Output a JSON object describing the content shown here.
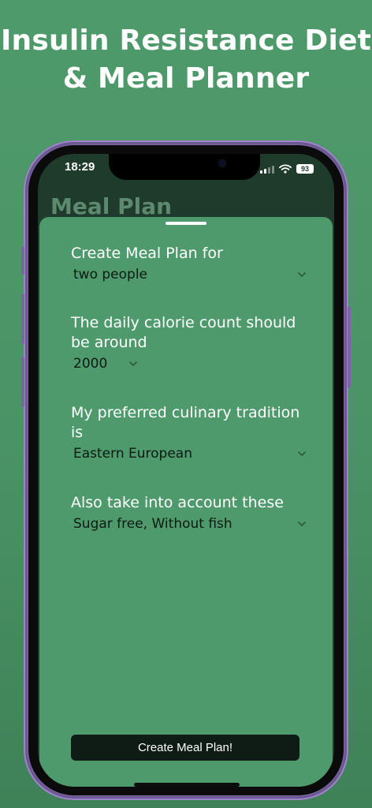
{
  "promo": {
    "line1": "Insulin Resistance Diet",
    "line2": "& Meal Planner"
  },
  "status_bar": {
    "time": "18:29",
    "battery": "93"
  },
  "screen": {
    "background_title": "Meal Plan"
  },
  "form": {
    "people": {
      "label": "Create Meal Plan for",
      "value": "two people"
    },
    "calories": {
      "label": "The daily calorie count should be around",
      "value": "2000"
    },
    "tradition": {
      "label": "My preferred culinary tradition is",
      "value": "Eastern European"
    },
    "restrictions": {
      "label": "Also take into account these",
      "value": "Sugar free, Without fish"
    }
  },
  "cta": {
    "label": "Create Meal Plan!"
  },
  "icons": {
    "signal": "signal-bars-icon",
    "wifi": "wifi-icon",
    "battery": "battery-icon",
    "chevron": "chevron-down-icon"
  },
  "colors": {
    "background": "#4f9a6b",
    "sheet": "#4f9a6c",
    "phone_frame": "#7f6aa8",
    "button": "#0f1c15"
  }
}
